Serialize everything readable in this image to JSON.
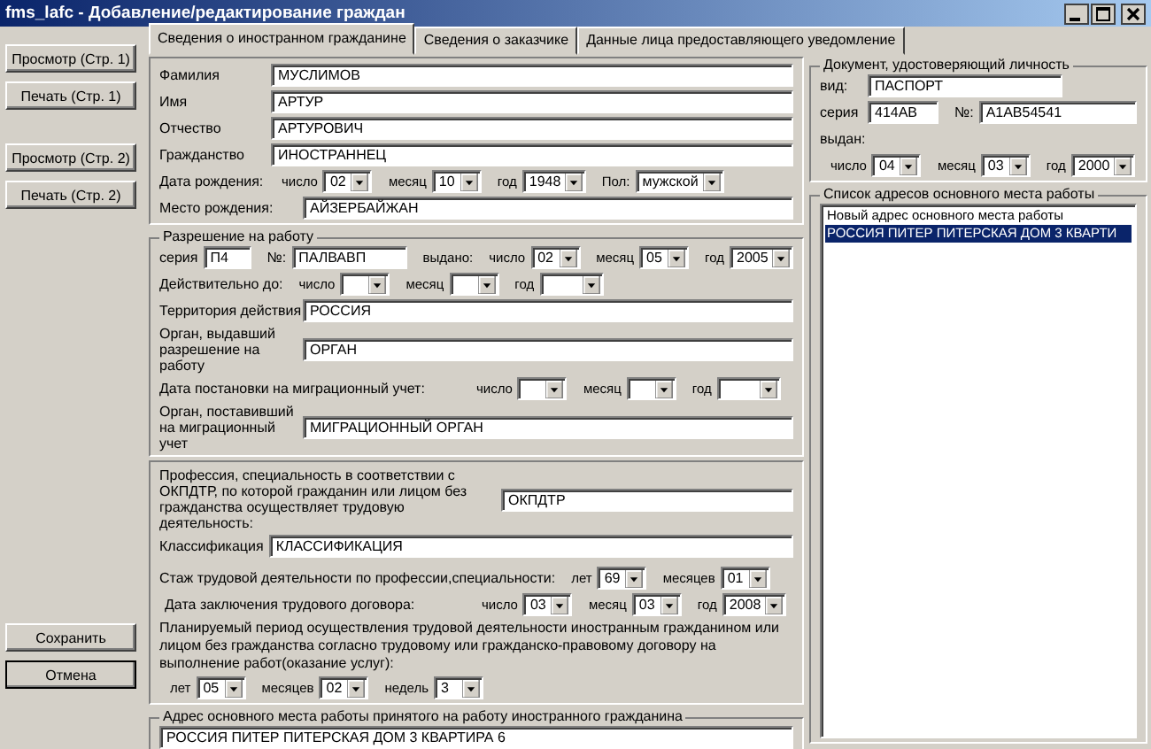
{
  "window": {
    "title": "fms_lafc - Добавление/редактирование граждан"
  },
  "side_buttons_top": [
    {
      "label": "Просмотр (Стр. 1)"
    },
    {
      "label": "Печать (Стр. 1)"
    },
    {
      "label": "Просмотр (Стр. 2)"
    },
    {
      "label": "Печать (Стр. 2)"
    }
  ],
  "side_buttons_bottom": [
    {
      "label": "Сохранить",
      "default": false
    },
    {
      "label": "Отмена",
      "default": true
    }
  ],
  "tabs": [
    {
      "label": "Сведения о иностранном гражданине",
      "selected": true
    },
    {
      "label": "Сведения о заказчике",
      "selected": false
    },
    {
      "label": "Данные лица предоставляющего уведомление",
      "selected": false
    }
  ],
  "person": {
    "fields": [
      {
        "label": "Фамилия",
        "value": "МУСЛИМОВ"
      },
      {
        "label": "Имя",
        "value": "АРТУР"
      },
      {
        "label": "Отчество",
        "value": "АРТУРОВИЧ"
      },
      {
        "label": "Гражданство",
        "value": "ИНОСТРАННЕЦ"
      }
    ],
    "birth_date": {
      "label": "Дата рождения:",
      "parts": [
        {
          "label": "число",
          "value": "02"
        },
        {
          "label": "месяц",
          "value": "10"
        },
        {
          "label": "год",
          "value": "1948"
        }
      ]
    },
    "sex": {
      "label": "Пол:",
      "value": "мужской"
    },
    "birthplace": {
      "label": "Место рождения:",
      "value": "АЙЗЕРБАЙЖАН"
    }
  },
  "work_permit": {
    "title": "Разрешение на работу",
    "series": {
      "label": "серия",
      "value": "П4"
    },
    "number": {
      "label": "№:",
      "value": "ПАЛВАВП"
    },
    "issued": {
      "label": "выдано:",
      "parts": [
        {
          "label": "число",
          "value": "02"
        },
        {
          "label": "месяц",
          "value": "05"
        },
        {
          "label": "год",
          "value": "2005"
        }
      ]
    },
    "valid_until": {
      "label": "Действительно до:",
      "parts": [
        {
          "label": "число"
        },
        {
          "label": "месяц"
        },
        {
          "label": "год"
        }
      ]
    },
    "territory": {
      "label": "Территория действия",
      "value": "РОССИЯ"
    },
    "issuer": {
      "label": "Орган, выдавший разрешение на работу",
      "value": "ОРГАН"
    },
    "registration_date": {
      "label": "Дата постановки на миграционный учет:",
      "parts": [
        {
          "label": "число"
        },
        {
          "label": "месяц"
        },
        {
          "label": "год"
        }
      ]
    },
    "registrar": {
      "label": "Орган, поставивший на миграционный учет",
      "value": "МИГРАЦИОННЫЙ ОРГАН"
    }
  },
  "employment": {
    "profession": {
      "label": "Профессия, специальность в соответствии с ОКПДТР, по которой гражданин или лицом без гражданства осуществляет трудовую деятельность:",
      "value": "ОКПДТР"
    },
    "classification": {
      "label": "Классификация",
      "value": "КЛАССИФИКАЦИЯ"
    },
    "experience": {
      "label": "Стаж трудовой деятельности по профессии,специальности:",
      "parts": [
        {
          "label": "лет",
          "value": "69"
        },
        {
          "label": "месяцев",
          "value": "01"
        }
      ]
    },
    "contract_date": {
      "label": "Дата заключения трудового договора:",
      "parts": [
        {
          "label": "число",
          "value": "03"
        },
        {
          "label": "месяц",
          "value": "03"
        },
        {
          "label": "год",
          "value": "2008"
        }
      ]
    },
    "planned_period": {
      "label": "Планируемый период осуществления трудовой деятельности иностранным гражданином или лицом без гражданства согласно трудовому или гражданско-правовому договору на выполнение работ(оказание услуг):",
      "parts": [
        {
          "label": "лет",
          "value": "05"
        },
        {
          "label": "месяцев",
          "value": "02"
        },
        {
          "label": "недель",
          "value": "3"
        }
      ]
    }
  },
  "work_address": {
    "title": "Адрес основного места работы принятого на работу иностранного гражданина",
    "value": "РОССИЯ ПИТЕР ПИТЕРСКАЯ ДОМ 3 КВАРТИРА 6"
  },
  "document": {
    "title": "Документ, удостоверяющий личность",
    "type": {
      "label": "вид:",
      "value": "ПАСПОРТ"
    },
    "series": {
      "label": "серия",
      "value": "414АВ"
    },
    "number": {
      "label": "№:",
      "value": "А1АВ54541"
    },
    "issued_label": "выдан:",
    "issued": [
      {
        "label": "число",
        "value": "04"
      },
      {
        "label": "месяц",
        "value": "03"
      },
      {
        "label": "год",
        "value": "2000"
      }
    ]
  },
  "address_list": {
    "title": "Список адресов основного места работы",
    "items": [
      {
        "text": "Новый адрес основного места работы",
        "selected": false
      },
      {
        "text": "РОССИЯ ПИТЕР ПИТЕРСКАЯ ДОМ 3 КВАРТИ",
        "selected": true
      }
    ]
  }
}
